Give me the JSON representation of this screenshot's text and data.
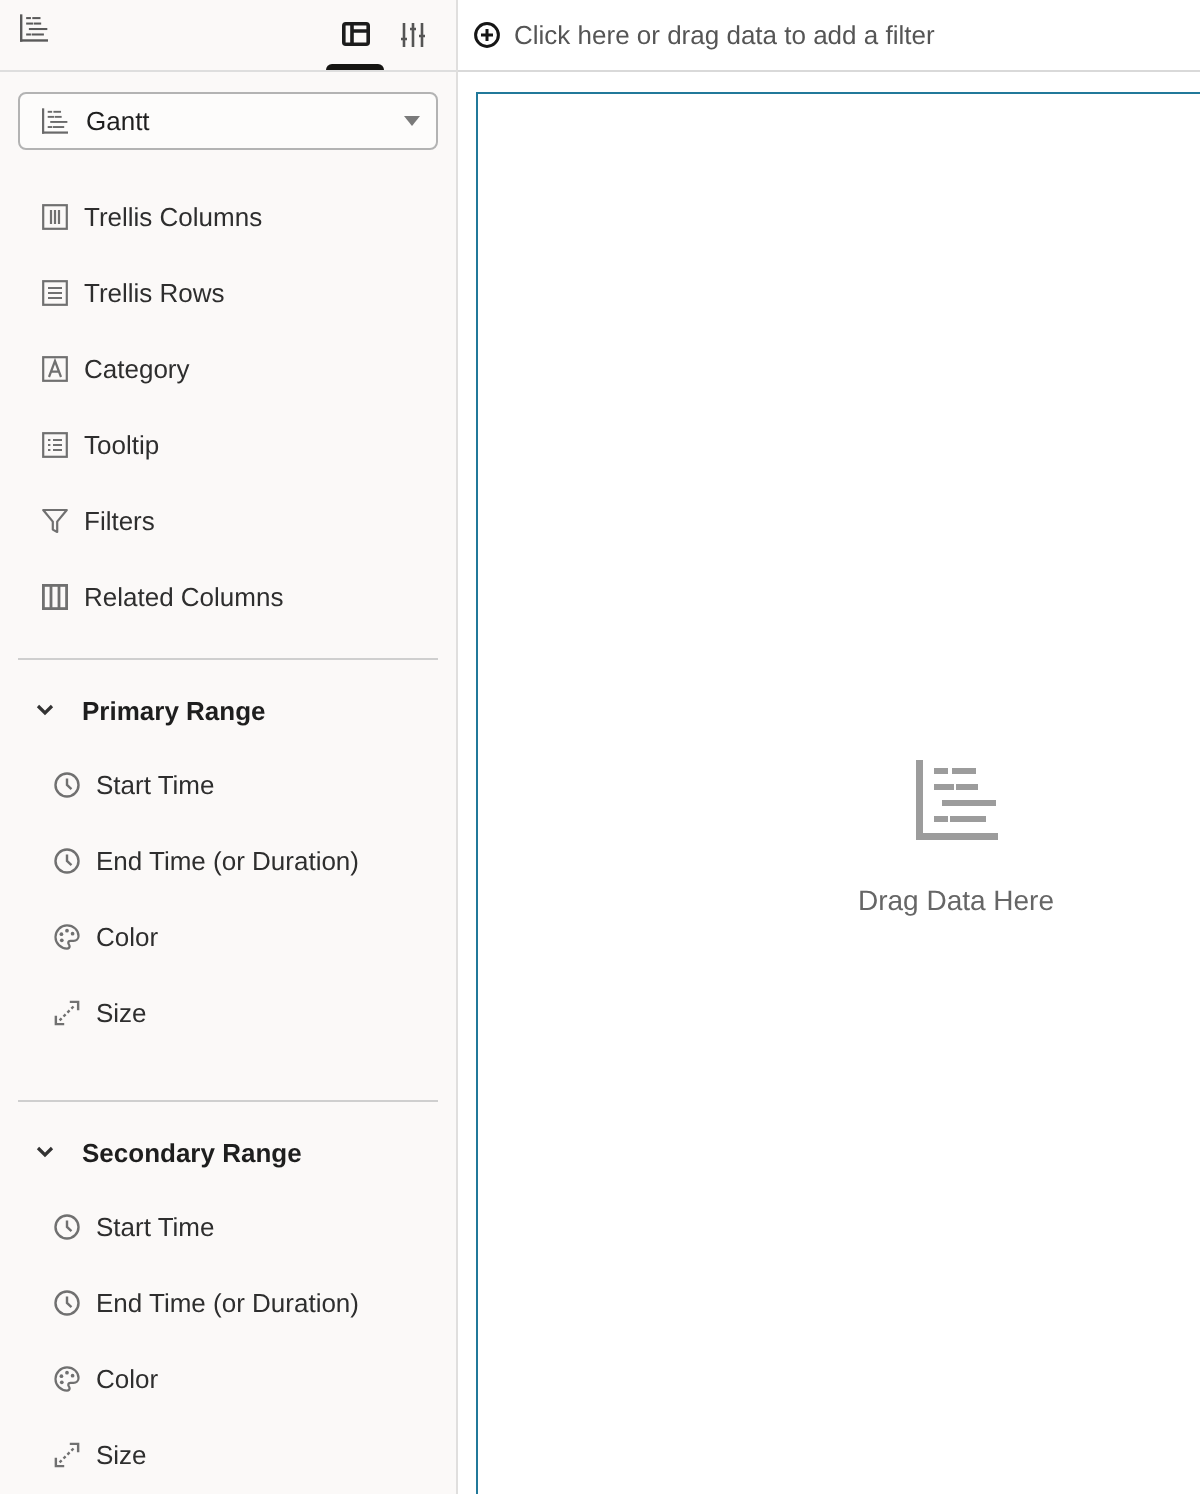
{
  "sidebar": {
    "tabs": [
      {
        "kind": "layout",
        "selected": true
      },
      {
        "kind": "sliders",
        "selected": false
      }
    ],
    "chart_type": {
      "value": "Gantt"
    },
    "drop_targets": [
      {
        "kind": "columns",
        "label": "Trellis Columns"
      },
      {
        "kind": "rows",
        "label": "Trellis Rows"
      },
      {
        "kind": "category",
        "label": "Category"
      },
      {
        "kind": "tooltip",
        "label": "Tooltip"
      },
      {
        "kind": "filters",
        "label": "Filters"
      },
      {
        "kind": "related",
        "label": "Related Columns"
      }
    ],
    "ranges": [
      {
        "title": "Primary Range",
        "expanded": true,
        "drop_targets": [
          {
            "kind": "time",
            "label": "Start Time"
          },
          {
            "kind": "time",
            "label": "End Time (or Duration)"
          },
          {
            "kind": "color",
            "label": "Color"
          },
          {
            "kind": "size",
            "label": "Size"
          }
        ]
      },
      {
        "title": "Secondary Range",
        "expanded": true,
        "drop_targets": [
          {
            "kind": "time",
            "label": "Start Time"
          },
          {
            "kind": "time",
            "label": "End Time (or Duration)"
          },
          {
            "kind": "color",
            "label": "Color"
          },
          {
            "kind": "size",
            "label": "Size"
          }
        ]
      }
    ]
  },
  "filter_bar": {
    "prompt": "Click here or drag data to add a filter"
  },
  "canvas": {
    "active": true,
    "message": "Drag Data Here"
  }
}
